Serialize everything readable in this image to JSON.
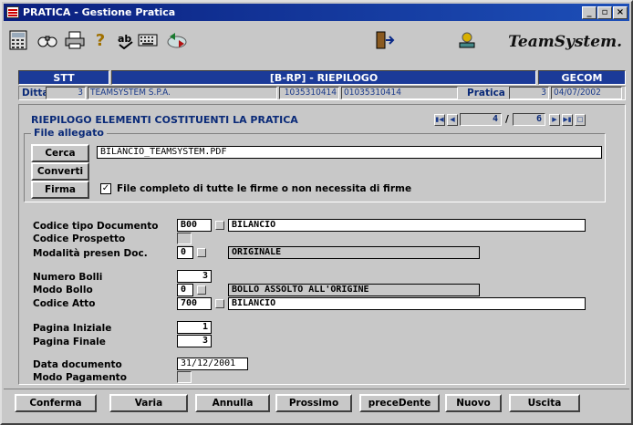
{
  "window": {
    "title": "PRATICA - Gestione Pratica",
    "minimize": "_",
    "maximize": "▫",
    "close": "×"
  },
  "brand": {
    "text": "TeamSystem."
  },
  "toolbar": {
    "icons": [
      "calculator-icon",
      "binoculars-icon",
      "printer-icon",
      "help-icon",
      "spellcheck-icon",
      "keyboard-icon",
      "exchange-icon",
      "exit-door-icon",
      "network-icon"
    ]
  },
  "header": {
    "left": "STT",
    "center": "[B-RP] - RIEPILOGO",
    "right": "GECOM"
  },
  "ditta": {
    "label": "Ditta",
    "code": "3",
    "name": "TEAMSYSTEM S.P.A.",
    "piva": "1035310414",
    "cf": "01035310414",
    "pratica_label": "Pratica",
    "pratica_num": "3",
    "pratica_date": "04/07/2002"
  },
  "section": {
    "title": "RIEPILOGO ELEMENTI COSTITUENTI LA PRATICA",
    "nav_current": "4",
    "nav_sep": "/",
    "nav_total": "6"
  },
  "file_allegato": {
    "legend": "File allegato",
    "cerca": "Cerca",
    "converti": "Converti",
    "firma": "Firma",
    "filename": "BILANCIO_TEAMSYSTEM.PDF",
    "check_mark": "✓",
    "check_label": "File completo di tutte le firme o non necessita di firme"
  },
  "form": {
    "codice_tipo_label": "Codice tipo Documento",
    "codice_tipo_code": "B00",
    "codice_tipo_desc": "BILANCIO",
    "codice_prospetto_label": "Codice Prospetto",
    "modalita_label": "Modalità presen Doc.",
    "modalita_code": "0",
    "modalita_desc": "ORIGINALE",
    "numero_bolli_label": "Numero Bolli",
    "numero_bolli": "3",
    "modo_bollo_label": "Modo Bollo",
    "modo_bollo_code": "0",
    "modo_bollo_desc": "BOLLO ASSOLTO ALL'ORIGINE",
    "codice_atto_label": "Codice Atto",
    "codice_atto_code": "700",
    "codice_atto_desc": "BILANCIO",
    "pagina_iniziale_label": "Pagina Iniziale",
    "pagina_iniziale": "1",
    "pagina_finale_label": "Pagina Finale",
    "pagina_finale": "3",
    "data_documento_label": "Data documento",
    "data_documento": "31/12/2001",
    "modo_pagamento_label": "Modo Pagamento"
  },
  "buttons": {
    "conferma": "Conferma",
    "varia": "Varia",
    "annulla": "Annulla",
    "prossimo": "Prossimo",
    "precedente": "preceDente",
    "nuovo": "Nuovo",
    "uscita": "Uscita"
  },
  "colors": {
    "titlebar": "#0a1f7e",
    "header_blue": "#1b3a98",
    "label_blue": "#0a2a78",
    "face": "#c8c8c8"
  }
}
